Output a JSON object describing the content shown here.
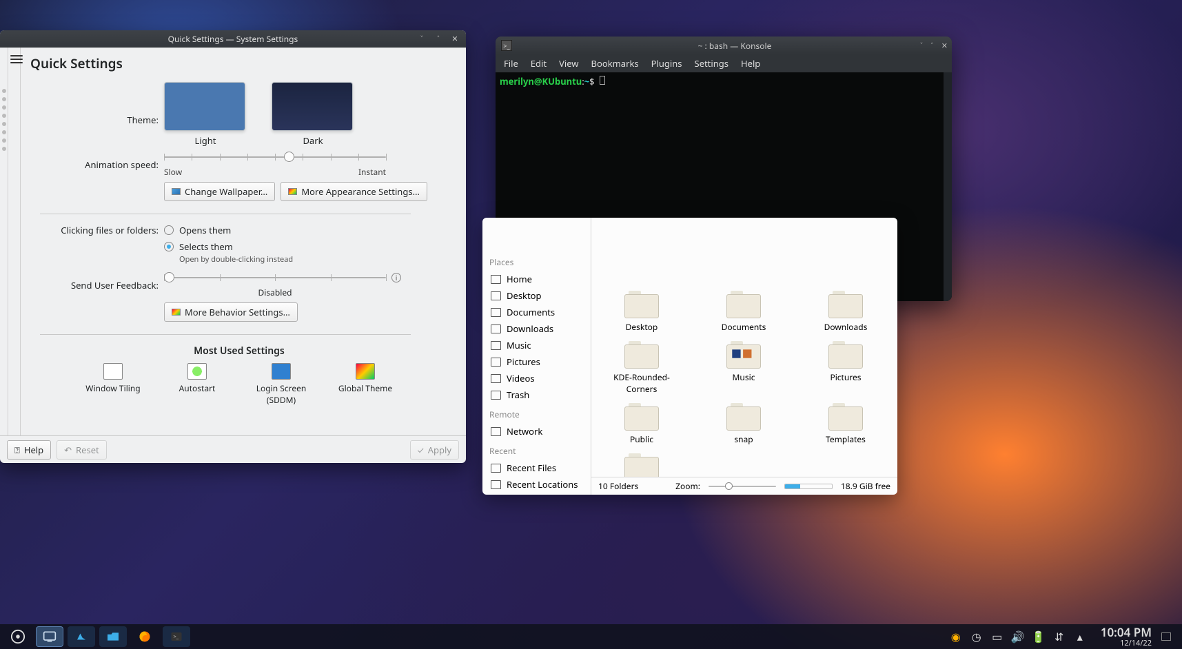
{
  "settings": {
    "window_title": "Quick Settings — System Settings",
    "heading": "Quick Settings",
    "theme_label": "Theme:",
    "themes": {
      "light": "Light",
      "dark": "Dark"
    },
    "anim_label": "Animation speed:",
    "anim_slow": "Slow",
    "anim_instant": "Instant",
    "btn_wallpaper": "Change Wallpaper…",
    "btn_appearance": "More Appearance Settings…",
    "click_label": "Clicking files or folders:",
    "click_opens": "Opens them",
    "click_selects": "Selects them",
    "click_hint": "Open by double-clicking instead",
    "feedback_label": "Send User Feedback:",
    "feedback_disabled": "Disabled",
    "btn_behavior": "More Behavior Settings…",
    "most_used_title": "Most Used Settings",
    "most_used": {
      "tiling": "Window Tiling",
      "autostart": "Autostart",
      "login": "Login Screen (SDDM)",
      "global": "Global Theme"
    },
    "btn_help": "Help",
    "btn_reset": "Reset",
    "btn_apply": "Apply"
  },
  "konsole": {
    "title": "~ : bash — Konsole",
    "menu": [
      "File",
      "Edit",
      "View",
      "Bookmarks",
      "Plugins",
      "Settings",
      "Help"
    ],
    "prompt_user": "merilyn@KUbuntu",
    "prompt_path": "~",
    "prompt_suffix": "$"
  },
  "dolphin": {
    "places_cat": "Places",
    "remote_cat": "Remote",
    "recent_cat": "Recent",
    "places": [
      "Home",
      "Desktop",
      "Documents",
      "Downloads",
      "Music",
      "Pictures",
      "Videos",
      "Trash"
    ],
    "remote": [
      "Network"
    ],
    "recent": [
      "Recent Files",
      "Recent Locations"
    ],
    "folders_row1": [
      "Desktop",
      "Documents",
      "Downloads"
    ],
    "folders_row2": [
      "KDE-Rounded-Corners",
      "Music",
      "Pictures"
    ],
    "folders_row3": [
      "Public",
      "snap",
      "Templates"
    ],
    "status_folders": "10 Folders",
    "zoom_label": "Zoom:",
    "disk_free": "18.9 GiB free"
  },
  "taskbar": {
    "time": "10:04 PM",
    "date": "12/14/22"
  }
}
